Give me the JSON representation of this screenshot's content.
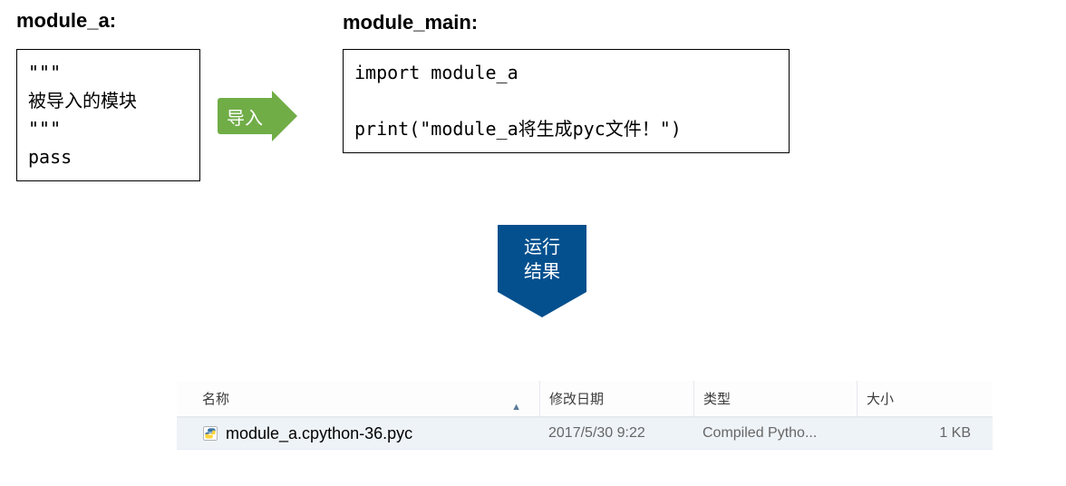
{
  "module_a": {
    "title": "module_a:",
    "code": "\"\"\"\n被导入的模块\n\"\"\"\npass"
  },
  "module_main": {
    "title": "module_main:",
    "code": "import module_a\n\nprint(\"module_a将生成pyc文件！\")"
  },
  "arrow_import_label": "导入",
  "result_banner": {
    "line1": "运行",
    "line2": "结果"
  },
  "file_view": {
    "columns": {
      "name": "名称",
      "date": "修改日期",
      "type": "类型",
      "size": "大小"
    },
    "row": {
      "filename": "module_a.cpython-36.pyc",
      "date": "2017/5/30 9:22",
      "type": "Compiled Pytho...",
      "size": "1 KB"
    }
  },
  "chart_data": {
    "type": "table",
    "title": "Python module import generates .pyc",
    "nodes": [
      {
        "id": "module_a",
        "label": "module_a",
        "code": "\"\"\"\\n被导入的模块\\n\"\"\"\\npass"
      },
      {
        "id": "module_main",
        "label": "module_main",
        "code": "import module_a\\n\\nprint(\\\"module_a将生成pyc文件！\\\")"
      },
      {
        "id": "result_file",
        "label": "module_a.cpython-36.pyc",
        "date": "2017/5/30 9:22",
        "type": "Compiled Python File",
        "size_kb": 1
      }
    ],
    "edges": [
      {
        "from": "module_a",
        "to": "module_main",
        "label": "导入"
      },
      {
        "from": "module_main",
        "to": "result_file",
        "label": "运行结果"
      }
    ]
  }
}
